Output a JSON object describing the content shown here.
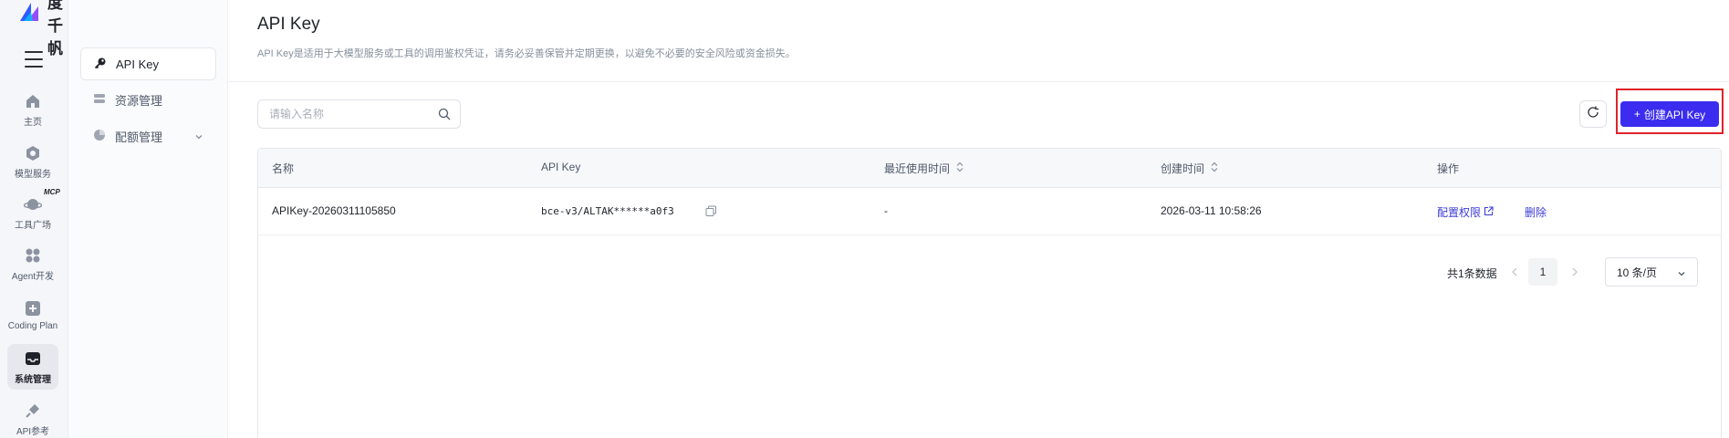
{
  "brand": {
    "name": "百度千帆"
  },
  "rail": {
    "items": [
      {
        "label": "主页"
      },
      {
        "label": "模型服务"
      },
      {
        "label": "工具广场",
        "badge": "MCP"
      },
      {
        "label": "Agent开发"
      },
      {
        "label": "Coding Plan"
      },
      {
        "label": "系统管理",
        "active": true
      },
      {
        "label": "API参考"
      }
    ]
  },
  "sidebar": {
    "items": [
      {
        "label": "API Key",
        "active": true
      },
      {
        "label": "资源管理"
      },
      {
        "label": "配额管理"
      }
    ]
  },
  "page": {
    "title": "API Key",
    "description": "API Key是适用于大模型服务或工具的调用鉴权凭证，请务必妥善保管并定期更换，以避免不必要的安全风险或资金损失。"
  },
  "toolbar": {
    "search_placeholder": "请输入名称",
    "create_label": "创建API Key",
    "create_prefix": "+"
  },
  "table": {
    "columns": [
      "名称",
      "API Key",
      "最近使用时间",
      "创建时间",
      "操作"
    ],
    "rows": [
      {
        "name": "APIKey-20260311105850",
        "api_key": "bce-v3/ALTAK******a0f3",
        "last_used": "-",
        "created": "2026-03-11 10:58:26",
        "actions": [
          "配置权限",
          "删除"
        ]
      }
    ]
  },
  "pagination": {
    "total_text": "共1条数据",
    "current_page": "1",
    "page_size": "10 条/页"
  },
  "colors": {
    "primary": "#3b2cf0",
    "link": "#3b3bd6",
    "highlight_border": "#e0222a"
  }
}
